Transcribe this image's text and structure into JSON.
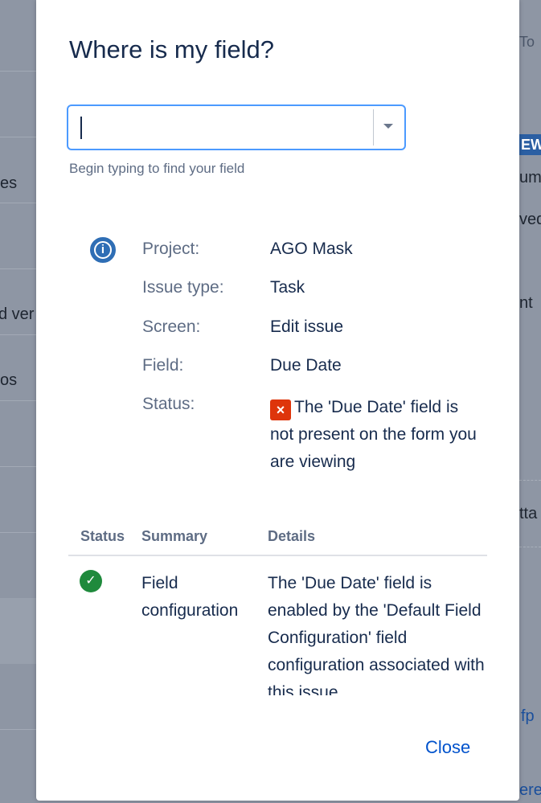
{
  "background": {
    "left_fragments": [
      "es",
      "d ver",
      "os"
    ],
    "right_fragments": [
      "To",
      "EW",
      "um",
      "ved",
      "nt",
      "tta",
      "fp",
      "ere"
    ]
  },
  "dialog": {
    "title": "Where is my field?",
    "field_search": {
      "value": "",
      "hint": "Begin typing to find your field"
    },
    "info": {
      "icon": "info-icon",
      "rows": [
        {
          "label": "Project:",
          "value": "AGO Mask"
        },
        {
          "label": "Issue type:",
          "value": "Task"
        },
        {
          "label": "Screen:",
          "value": "Edit issue"
        },
        {
          "label": "Field:",
          "value": "Due Date"
        }
      ],
      "status_label": "Status:",
      "status_icon": "error-icon",
      "status_message": "The 'Due Date' field is not present on the form you are viewing"
    },
    "table": {
      "headers": {
        "status": "Status",
        "summary": "Summary",
        "details": "Details"
      },
      "rows": [
        {
          "status_icon": "success-icon",
          "summary": "Field configuration",
          "details": "The 'Due Date' field is enabled by the 'Default Field Configuration' field configuration associated with this issue."
        }
      ]
    },
    "close_label": "Close"
  },
  "colors": {
    "accent": "#0052cc",
    "focus_border": "#4c9aff",
    "error": "#de350b",
    "success": "#1f8a3c",
    "info": "#2f6eb5"
  }
}
